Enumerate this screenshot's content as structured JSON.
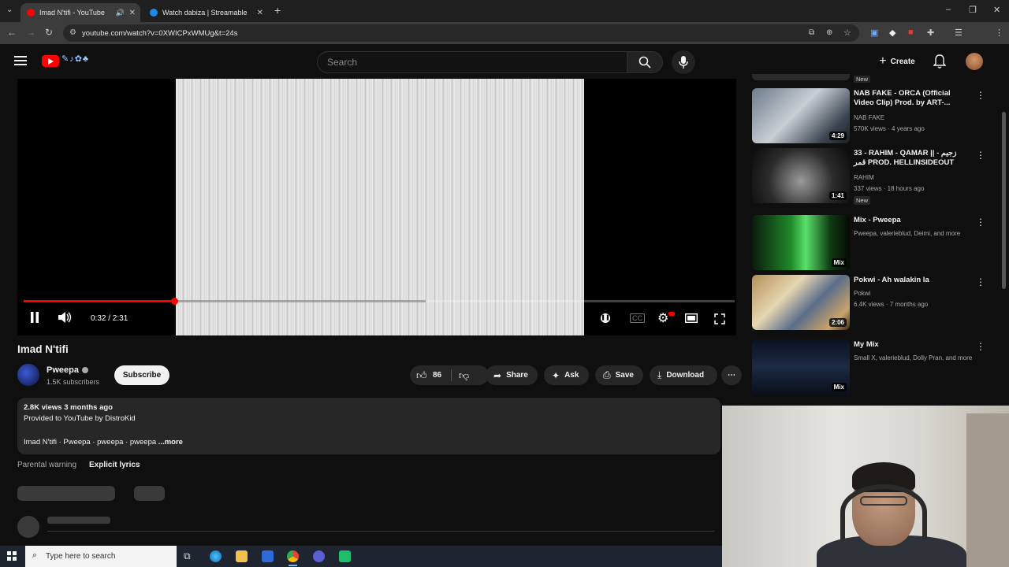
{
  "browser": {
    "tabs": [
      {
        "title": "Imad N'tifi - YouTube",
        "active": true
      },
      {
        "title": "Watch dabiza | Streamable",
        "active": false
      }
    ],
    "url": "youtube.com/watch?v=0XWICPxWMUg&t=24s"
  },
  "header": {
    "search_placeholder": "Search",
    "create_label": "Create"
  },
  "player": {
    "current_time": "0:32",
    "duration": "2:31",
    "time_display": "0:32 / 2:31",
    "progress_fraction": 0.212
  },
  "video": {
    "title": "Imad N'tifi",
    "channel": "Pweepa",
    "subscribers": "1.5K subscribers",
    "subscribe_label": "Subscribe",
    "likes": "86",
    "actions": {
      "share": "Share",
      "ask": "Ask",
      "save": "Save",
      "download": "Download"
    },
    "description": {
      "stats": "2.8K views  3 months ago",
      "provided": "Provided to YouTube by DistroKid",
      "line": "Imad N'tifi · Pweepa · pweepa · pweepa",
      "more": "...more"
    },
    "parental_warning_label": "Parental warning",
    "parental_warning_value": "Explicit lyrics"
  },
  "sidebar": {
    "top_new_badge": "New",
    "recommendations": [
      {
        "title": "NAB FAKE - ORCA (Official Video Clip) Prod. by ART-...",
        "channel": "NAB FAKE",
        "meta": "570K views · 4 years ago",
        "badge": "4:29",
        "new": ""
      },
      {
        "title": "33 - RAHIM - QAMAR || زجيم - قمر PROD. HELLINSIDEOUT",
        "channel": "RAHIM",
        "meta": "337 views · 18 hours ago",
        "badge": "1:41",
        "new": "New"
      },
      {
        "title": "Mix - Pweepa",
        "channel": "Pweepa, valerieblud, Deimi, and more",
        "meta": "",
        "badge": "Mix",
        "new": ""
      },
      {
        "title": "Pokwi - Ah walakin la",
        "channel": "Pokwi",
        "meta": "6.4K views · 7 months ago",
        "badge": "2:06",
        "new": ""
      },
      {
        "title": "My Mix",
        "channel": "Small X, valerieblud, Dolly Pran, and more",
        "meta": "",
        "badge": "Mix",
        "new": ""
      }
    ]
  },
  "taskbar": {
    "search_placeholder": "Type here to search"
  },
  "colors": {
    "accent": "#ff0000",
    "background": "#0f0f0f",
    "pill": "#272727"
  }
}
